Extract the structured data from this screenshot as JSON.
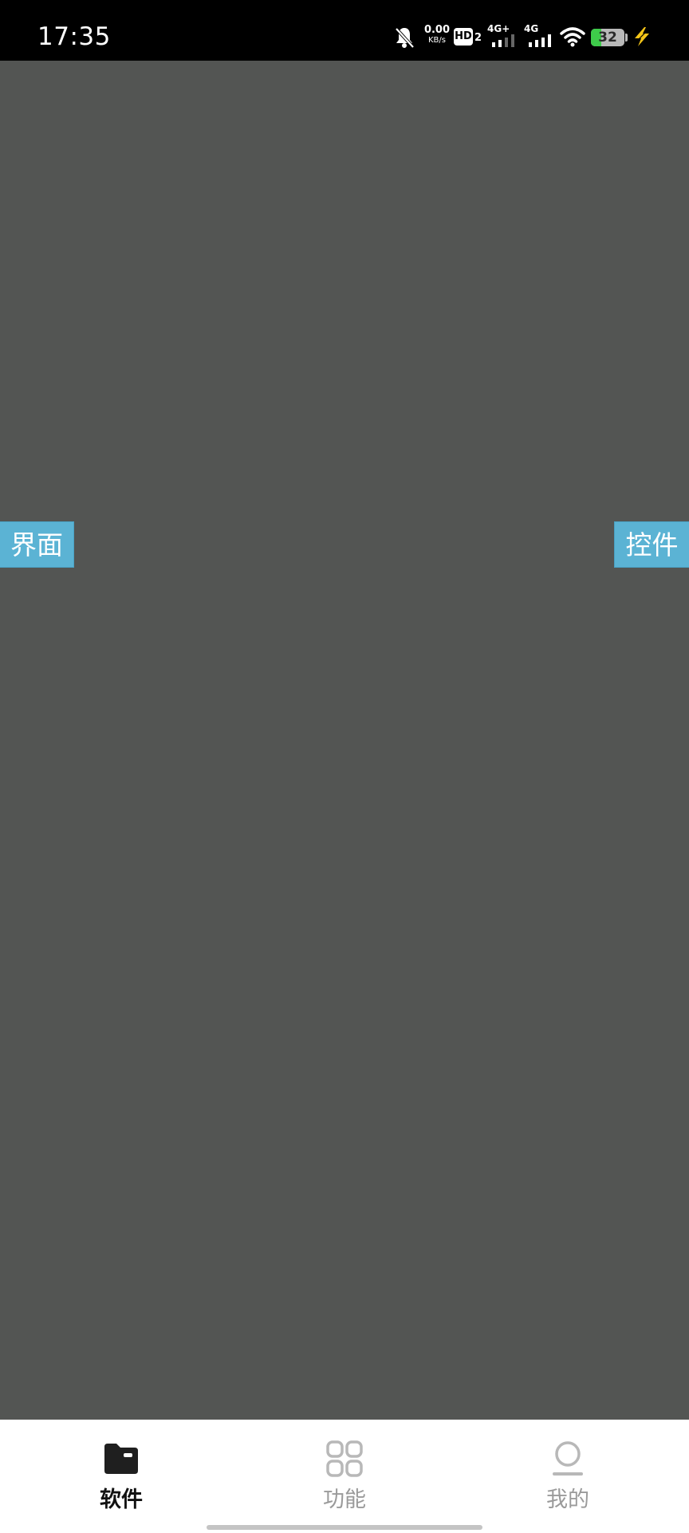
{
  "status_bar": {
    "time": "17:35",
    "net_speed_value": "0.00",
    "net_speed_unit": "KB/s",
    "hd_label": "HD",
    "hd_sub": "2",
    "sim1_network": "4G+",
    "sim2_network": "4G",
    "battery_level": "32",
    "battery_fraction": 0.32,
    "battery_color": "#3ecb4a",
    "charging_color": "#f5c518",
    "icons": [
      "bell-off-icon",
      "hd-icon",
      "signal-icon",
      "signal-icon",
      "wifi-icon",
      "battery-icon",
      "charging-icon"
    ]
  },
  "content": {
    "background": "#535553",
    "left_tab_label": "界面",
    "right_tab_label": "控件",
    "tab_color": "#5bb3d4"
  },
  "bottom_nav": {
    "items": [
      {
        "label": "软件",
        "icon": "folder-icon",
        "active": true
      },
      {
        "label": "功能",
        "icon": "grid-icon",
        "active": false
      },
      {
        "label": "我的",
        "icon": "profile-icon",
        "active": false
      }
    ]
  }
}
